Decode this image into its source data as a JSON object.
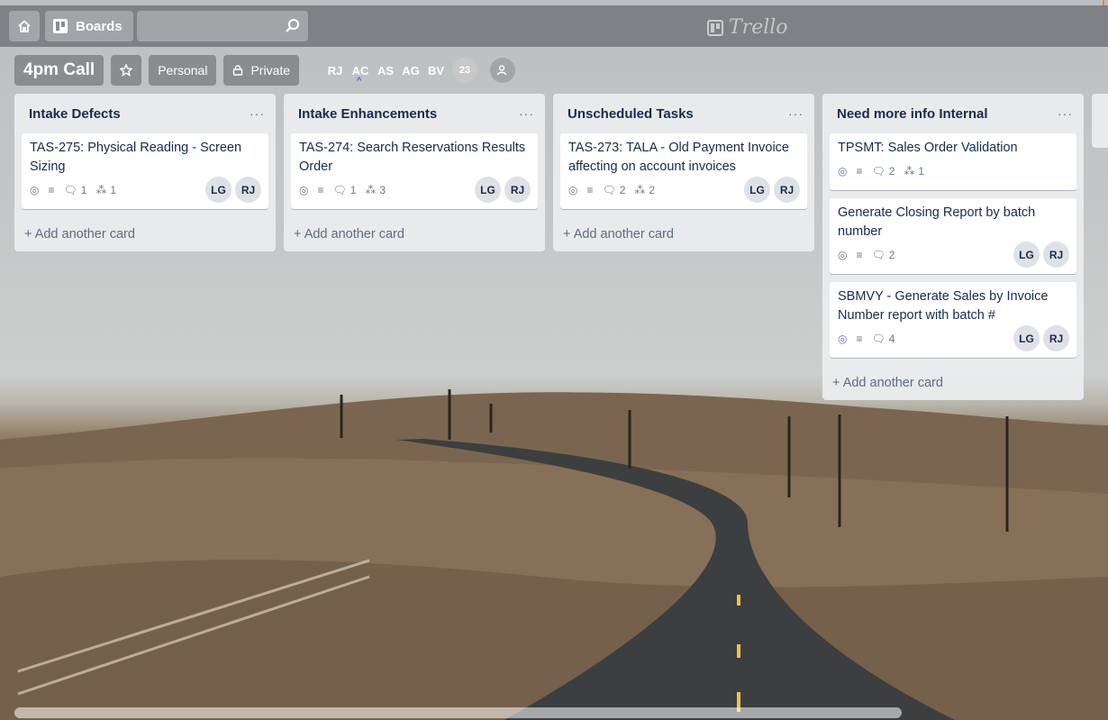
{
  "header": {
    "boards_label": "Boards",
    "logo_text": "Trello"
  },
  "board": {
    "title": "4pm Call",
    "team_label": "Personal",
    "visibility_label": "Private",
    "members": [
      "RJ",
      "AC",
      "AS",
      "AG",
      "BV"
    ],
    "member_overflow_count": "23"
  },
  "lists": [
    {
      "title": "Intake Defects",
      "add_label": "+ Add another card",
      "cards": [
        {
          "title": "TAS-275: Physical Reading - Screen Sizing",
          "comments": "1",
          "attachments": "1",
          "members": [
            "LG",
            "RJ"
          ]
        }
      ]
    },
    {
      "title": "Intake Enhancements",
      "add_label": "+ Add another card",
      "cards": [
        {
          "title": "TAS-274: Search Reservations Results Order",
          "comments": "1",
          "attachments": "3",
          "members": [
            "LG",
            "RJ"
          ]
        }
      ]
    },
    {
      "title": "Unscheduled Tasks",
      "add_label": "+ Add another card",
      "cards": [
        {
          "title": "TAS-273: TALA - Old Payment Invoice affecting on account invoices",
          "comments": "2",
          "attachments": "2",
          "members": [
            "LG",
            "RJ"
          ]
        }
      ]
    },
    {
      "title": "Need more info Internal",
      "add_label": "+ Add another card",
      "cards": [
        {
          "title": "TPSMT: Sales Order Validation",
          "comments": "2",
          "attachments": "1",
          "members": []
        },
        {
          "title": "Generate Closing Report by batch number",
          "comments": "2",
          "attachments": null,
          "members": [
            "LG",
            "RJ"
          ]
        },
        {
          "title": "SBMVY - Generate Sales by Invoice Number report with batch #",
          "comments": "4",
          "attachments": null,
          "members": [
            "LG",
            "RJ"
          ]
        }
      ]
    }
  ],
  "colors": {
    "header_bg": "#6e7073",
    "list_bg": "#ecedee",
    "card_text": "#172b4d",
    "muted_text": "#5e6c84",
    "avatar_bg": "#dfe1e6"
  }
}
